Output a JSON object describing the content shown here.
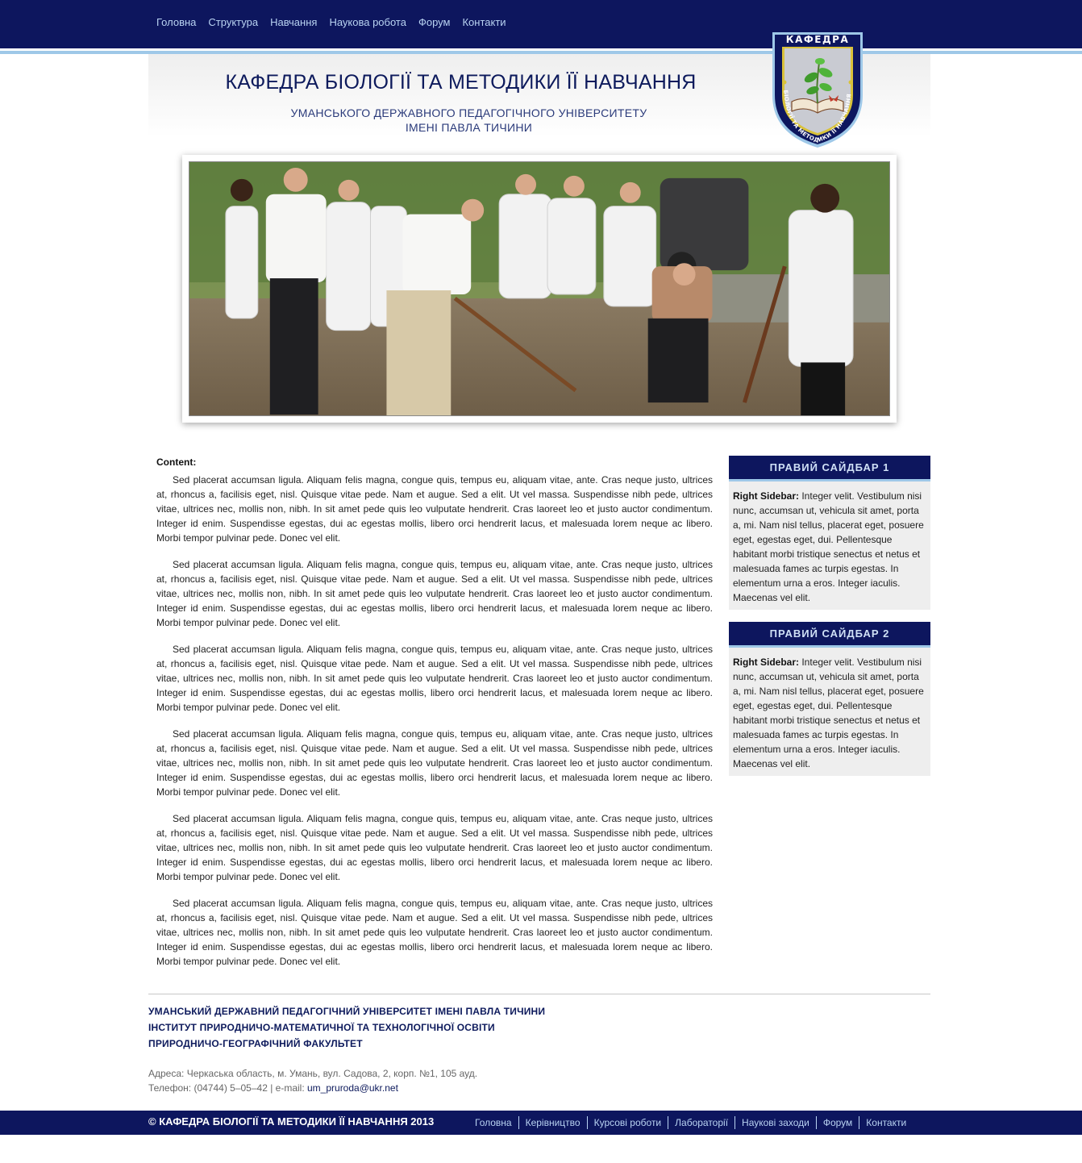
{
  "top_nav": [
    "Головна",
    "Структура",
    "Навчання",
    "Наукова робота",
    "Форум",
    "Контакти"
  ],
  "header": {
    "title": "КАФЕДРА БІОЛОГІЇ ТА МЕТОДИКИ ЇЇ НАВЧАННЯ",
    "subtitle_line1": "УМАНСЬКОГО ДЕРЖАВНОГО ПЕДАГОГІЧНОГО УНІВЕРСИТЕТУ",
    "subtitle_line2": "ІМЕНІ ПАВЛА ТИЧИНИ",
    "emblem_top": "КАФЕДРА",
    "emblem_ring": "БІОЛОГІЇ ТА МЕТОДИКИ ЇЇ НАВЧАННЯ"
  },
  "content": {
    "label": "Content:",
    "paragraphs": [
      "Sed placerat accumsan ligula. Aliquam felis magna, congue quis, tempus eu, aliquam vitae, ante. Cras neque justo, ultrices at, rhoncus a, facilisis eget, nisl. Quisque vitae pede. Nam et augue. Sed a elit. Ut vel massa. Suspendisse nibh pede, ultrices vitae, ultrices nec, mollis non, nibh. In sit amet pede quis leo vulputate hendrerit. Cras laoreet leo et justo auctor condimentum. Integer id enim. Suspendisse egestas, dui ac egestas mollis, libero orci hendrerit lacus, et malesuada lorem neque ac libero. Morbi tempor pulvinar pede. Donec vel elit.",
      "Sed placerat accumsan ligula. Aliquam felis magna, congue quis, tempus eu, aliquam vitae, ante. Cras neque justo, ultrices at, rhoncus a, facilisis eget, nisl. Quisque vitae pede. Nam et augue. Sed a elit. Ut vel massa. Suspendisse nibh pede, ultrices vitae, ultrices nec, mollis non, nibh. In sit amet pede quis leo vulputate hendrerit. Cras laoreet leo et justo auctor condimentum. Integer id enim. Suspendisse egestas, dui ac egestas mollis, libero orci hendrerit lacus, et malesuada lorem neque ac libero. Morbi tempor pulvinar pede. Donec vel elit.",
      "Sed placerat accumsan ligula. Aliquam felis magna, congue quis, tempus eu, aliquam vitae, ante. Cras neque justo, ultrices at, rhoncus a, facilisis eget, nisl. Quisque vitae pede. Nam et augue. Sed a elit. Ut vel massa. Suspendisse nibh pede, ultrices vitae, ultrices nec, mollis non, nibh. In sit amet pede quis leo vulputate hendrerit. Cras laoreet leo et justo auctor condimentum. Integer id enim. Suspendisse egestas, dui ac egestas mollis, libero orci hendrerit lacus, et malesuada lorem neque ac libero. Morbi tempor pulvinar pede. Donec vel elit.",
      "Sed placerat accumsan ligula. Aliquam felis magna, congue quis, tempus eu, aliquam vitae, ante. Cras neque justo, ultrices at, rhoncus a, facilisis eget, nisl. Quisque vitae pede. Nam et augue. Sed a elit. Ut vel massa. Suspendisse nibh pede, ultrices vitae, ultrices nec, mollis non, nibh. In sit amet pede quis leo vulputate hendrerit. Cras laoreet leo et justo auctor condimentum. Integer id enim. Suspendisse egestas, dui ac egestas mollis, libero orci hendrerit lacus, et malesuada lorem neque ac libero. Morbi tempor pulvinar pede. Donec vel elit.",
      "Sed placerat accumsan ligula. Aliquam felis magna, congue quis, tempus eu, aliquam vitae, ante. Cras neque justo, ultrices at, rhoncus a, facilisis eget, nisl. Quisque vitae pede. Nam et augue. Sed a elit. Ut vel massa. Suspendisse nibh pede, ultrices vitae, ultrices nec, mollis non, nibh. In sit amet pede quis leo vulputate hendrerit. Cras laoreet leo et justo auctor condimentum. Integer id enim. Suspendisse egestas, dui ac egestas mollis, libero orci hendrerit lacus, et malesuada lorem neque ac libero. Morbi tempor pulvinar pede. Donec vel elit.",
      "Sed placerat accumsan ligula. Aliquam felis magna, congue quis, tempus eu, aliquam vitae, ante. Cras neque justo, ultrices at, rhoncus a, facilisis eget, nisl. Quisque vitae pede. Nam et augue. Sed a elit. Ut vel massa. Suspendisse nibh pede, ultrices vitae, ultrices nec, mollis non, nibh. In sit amet pede quis leo vulputate hendrerit. Cras laoreet leo et justo auctor condimentum. Integer id enim. Suspendisse egestas, dui ac egestas mollis, libero orci hendrerit lacus, et malesuada lorem neque ac libero. Morbi tempor pulvinar pede. Donec vel elit."
    ]
  },
  "sidebar": [
    {
      "title": "ПРАВИЙ САЙДБАР 1",
      "label": "Right Sidebar:",
      "text": " Integer velit. Vestibulum nisi nunc, accumsan ut, vehicula sit amet, porta a, mi. Nam nisl tellus, placerat eget, posuere eget, egestas eget, dui. Pellentesque habitant morbi tristique senectus et netus et malesuada fames ac turpis egestas. In elementum urna a eros. Integer iaculis. Maecenas vel elit."
    },
    {
      "title": "ПРАВИЙ САЙДБАР 2",
      "label": "Right Sidebar:",
      "text": " Integer velit. Vestibulum nisi nunc, accumsan ut, vehicula sit amet, porta a, mi. Nam nisl tellus, placerat eget, posuere eget, egestas eget, dui. Pellentesque habitant morbi tristique senectus et netus et malesuada fames ac turpis egestas. In elementum urna a eros. Integer iaculis. Maecenas vel elit."
    }
  ],
  "footer": {
    "org_lines": [
      "УМАНСЬКИЙ ДЕРЖАВНИЙ ПЕДАГОГІЧНИЙ УНІВЕРСИТЕТ ІМЕНІ ПАВЛА ТИЧИНИ",
      "ІНСТИТУТ ПРИРОДНИЧО-МАТЕМАТИЧНОЇ ТА ТЕХНОЛОГІЧНОЇ ОСВІТИ",
      "ПРИРОДНИЧО-ГЕОГРАФІЧНИЙ ФАКУЛЬТЕТ"
    ],
    "address": "Адреса: Черкаська область, м. Умань, вул. Садова, 2, корп. №1, 105 ауд.",
    "phone_prefix": "Телефон: (04744) 5–05–42 | e-mail: ",
    "email": "um_pruroda@ukr.net",
    "copyright": "© КАФЕДРА БІОЛОГІЇ ТА МЕТОДИКИ ЇЇ НАВЧАННЯ 2013",
    "bottom_nav": [
      "Головна",
      "Керівництво",
      "Курсові роботи",
      "Лабораторії",
      "Наукові заходи",
      "Форум",
      "Контакти"
    ]
  },
  "colors": {
    "navy": "#0d165e",
    "light_blue": "#9ec8e8",
    "nav_link": "#b9d3f2",
    "sidebar_bg": "#eeeeee"
  }
}
